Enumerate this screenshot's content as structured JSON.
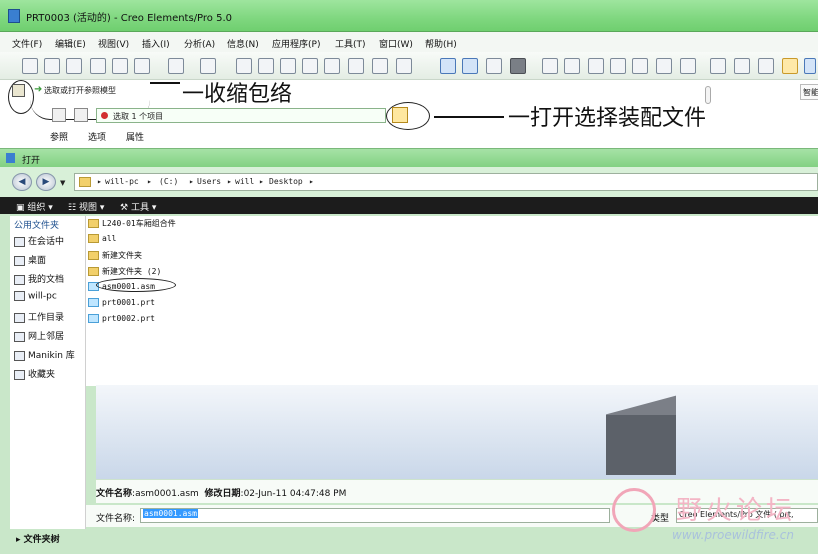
{
  "window": {
    "title": "PRT0003 (活动的) - Creo Elements/Pro 5.0"
  },
  "menu": [
    "文件(F)",
    "编辑(E)",
    "视图(V)",
    "插入(I)",
    "分析(A)",
    "信息(N)",
    "应用程序(P)",
    "工具(T)",
    "窗口(W)",
    "帮助(H)"
  ],
  "dashboard": {
    "prompt": "选取或打开参照模型",
    "annotation_left": "一收缩包络",
    "select_field": "选取 1 个项目",
    "annotation_right": "一打开选择装配文件",
    "smart_label": "智能",
    "tabs": [
      "参照",
      "选项",
      "属性"
    ]
  },
  "dialog": {
    "title": "打开",
    "path": [
      "will-pc",
      "(C:)",
      "Users",
      "will",
      "Desktop"
    ],
    "commands": [
      "组织",
      "视图",
      "工具"
    ],
    "left_header": "公用文件夹",
    "left_items": [
      {
        "icon": "session-icon",
        "label": "在会话中"
      },
      {
        "icon": "desktop-icon",
        "label": "桌面"
      },
      {
        "icon": "documents-icon",
        "label": "我的文档"
      },
      {
        "icon": "computer-icon",
        "label": "will-pc"
      },
      {
        "icon": "workdir-icon",
        "label": "工作目录"
      },
      {
        "icon": "network-icon",
        "label": "网上邻居"
      },
      {
        "icon": "manikin-icon",
        "label": "Manikin 库"
      },
      {
        "icon": "favorites-icon",
        "label": "收藏夹"
      }
    ],
    "files": [
      {
        "type": "folder",
        "name": "L240-01车厢组合件"
      },
      {
        "type": "folder",
        "name": "all"
      },
      {
        "type": "folder",
        "name": "新建文件夹"
      },
      {
        "type": "folder",
        "name": "新建文件夹 (2)"
      },
      {
        "type": "file",
        "name": "asm0001.asm"
      },
      {
        "type": "file",
        "name": "prt0001.prt"
      },
      {
        "type": "file",
        "name": "prt0002.prt"
      }
    ],
    "info": {
      "name_label": "文件名称",
      "name_value": "asm0001.asm",
      "date_label": "修改日期",
      "date_value": "02-Jun-11 04:47:48 PM"
    },
    "filename_label": "文件名称:",
    "filename_value": "asm0001.asm",
    "type_label": "类型",
    "type_value": "Creo Elements/Pro 文件 (.prt,",
    "folder_tree": "文件夹树"
  },
  "watermark": {
    "cn": "野火论坛",
    "url": "www.proewildfire.cn"
  }
}
